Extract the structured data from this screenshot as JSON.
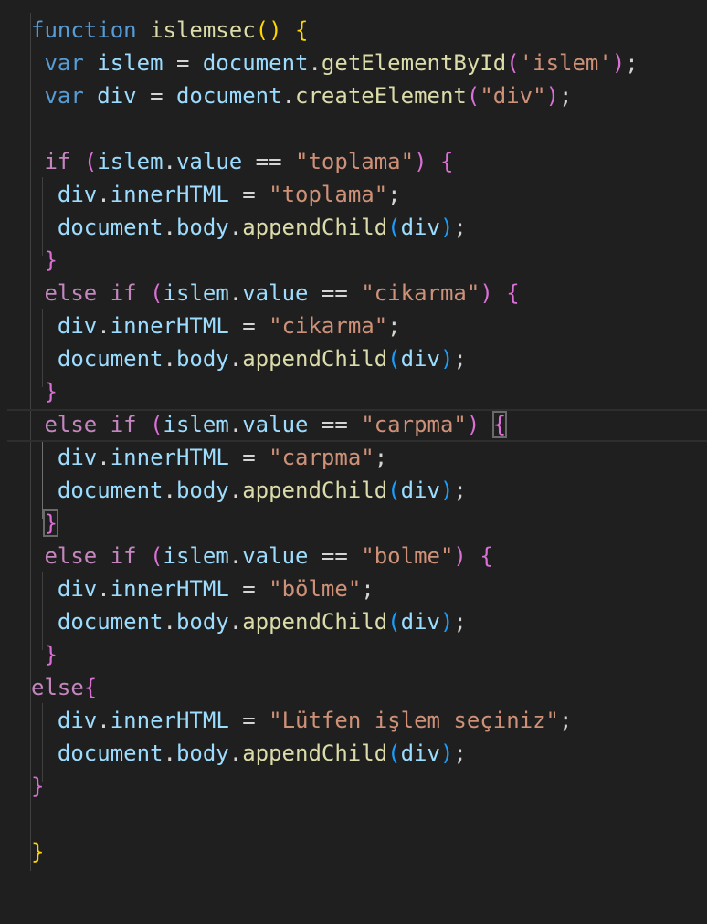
{
  "colors": {
    "background": "#1f1f1f",
    "keyword": "#569cd6",
    "control": "#c586c0",
    "function": "#dcdcaa",
    "variable": "#9cdcfe",
    "string": "#ce9178",
    "bracket_level_1": "#ffd700",
    "bracket_level_2": "#da70d6",
    "bracket_level_3": "#179fff"
  },
  "editor": {
    "highlighted_line": 13,
    "lines": [
      [
        {
          "t": "function",
          "c": "keyword"
        },
        {
          "t": " ",
          "c": "plain"
        },
        {
          "t": "islemsec",
          "c": "function"
        },
        {
          "t": "()",
          "c": "paren1"
        },
        {
          "t": " ",
          "c": "plain"
        },
        {
          "t": "{",
          "c": "paren1"
        }
      ],
      [
        {
          "t": " ",
          "c": "plain"
        },
        {
          "t": "var",
          "c": "keyword"
        },
        {
          "t": " ",
          "c": "plain"
        },
        {
          "t": "islem",
          "c": "variable"
        },
        {
          "t": " = ",
          "c": "operator"
        },
        {
          "t": "document",
          "c": "variable"
        },
        {
          "t": ".",
          "c": "punct"
        },
        {
          "t": "getElementById",
          "c": "function"
        },
        {
          "t": "(",
          "c": "paren2"
        },
        {
          "t": "'islem'",
          "c": "string"
        },
        {
          "t": ")",
          "c": "paren2"
        },
        {
          "t": ";",
          "c": "punct"
        }
      ],
      [
        {
          "t": " ",
          "c": "plain"
        },
        {
          "t": "var",
          "c": "keyword"
        },
        {
          "t": " ",
          "c": "plain"
        },
        {
          "t": "div",
          "c": "variable"
        },
        {
          "t": " = ",
          "c": "operator"
        },
        {
          "t": "document",
          "c": "variable"
        },
        {
          "t": ".",
          "c": "punct"
        },
        {
          "t": "createElement",
          "c": "function"
        },
        {
          "t": "(",
          "c": "paren2"
        },
        {
          "t": "\"div\"",
          "c": "string"
        },
        {
          "t": ")",
          "c": "paren2"
        },
        {
          "t": ";",
          "c": "punct"
        }
      ],
      [],
      [
        {
          "t": " ",
          "c": "plain"
        },
        {
          "t": "if",
          "c": "control"
        },
        {
          "t": " ",
          "c": "plain"
        },
        {
          "t": "(",
          "c": "paren2"
        },
        {
          "t": "islem",
          "c": "variable"
        },
        {
          "t": ".",
          "c": "punct"
        },
        {
          "t": "value",
          "c": "property"
        },
        {
          "t": " == ",
          "c": "operator"
        },
        {
          "t": "\"toplama\"",
          "c": "string"
        },
        {
          "t": ")",
          "c": "paren2"
        },
        {
          "t": " ",
          "c": "plain"
        },
        {
          "t": "{",
          "c": "paren2"
        }
      ],
      [
        {
          "t": "  ",
          "c": "plain"
        },
        {
          "t": "div",
          "c": "variable"
        },
        {
          "t": ".",
          "c": "punct"
        },
        {
          "t": "innerHTML",
          "c": "property"
        },
        {
          "t": " = ",
          "c": "operator"
        },
        {
          "t": "\"toplama\"",
          "c": "string"
        },
        {
          "t": ";",
          "c": "punct"
        }
      ],
      [
        {
          "t": "  ",
          "c": "plain"
        },
        {
          "t": "document",
          "c": "variable"
        },
        {
          "t": ".",
          "c": "punct"
        },
        {
          "t": "body",
          "c": "property"
        },
        {
          "t": ".",
          "c": "punct"
        },
        {
          "t": "appendChild",
          "c": "function"
        },
        {
          "t": "(",
          "c": "paren3"
        },
        {
          "t": "div",
          "c": "variable"
        },
        {
          "t": ")",
          "c": "paren3"
        },
        {
          "t": ";",
          "c": "punct"
        }
      ],
      [
        {
          "t": " ",
          "c": "plain"
        },
        {
          "t": "}",
          "c": "paren2"
        }
      ],
      [
        {
          "t": " ",
          "c": "plain"
        },
        {
          "t": "else",
          "c": "control"
        },
        {
          "t": " ",
          "c": "plain"
        },
        {
          "t": "if",
          "c": "control"
        },
        {
          "t": " ",
          "c": "plain"
        },
        {
          "t": "(",
          "c": "paren2"
        },
        {
          "t": "islem",
          "c": "variable"
        },
        {
          "t": ".",
          "c": "punct"
        },
        {
          "t": "value",
          "c": "property"
        },
        {
          "t": " == ",
          "c": "operator"
        },
        {
          "t": "\"cikarma\"",
          "c": "string"
        },
        {
          "t": ")",
          "c": "paren2"
        },
        {
          "t": " ",
          "c": "plain"
        },
        {
          "t": "{",
          "c": "paren2"
        }
      ],
      [
        {
          "t": "  ",
          "c": "plain"
        },
        {
          "t": "div",
          "c": "variable"
        },
        {
          "t": ".",
          "c": "punct"
        },
        {
          "t": "innerHTML",
          "c": "property"
        },
        {
          "t": " = ",
          "c": "operator"
        },
        {
          "t": "\"cikarma\"",
          "c": "string"
        },
        {
          "t": ";",
          "c": "punct"
        }
      ],
      [
        {
          "t": "  ",
          "c": "plain"
        },
        {
          "t": "document",
          "c": "variable"
        },
        {
          "t": ".",
          "c": "punct"
        },
        {
          "t": "body",
          "c": "property"
        },
        {
          "t": ".",
          "c": "punct"
        },
        {
          "t": "appendChild",
          "c": "function"
        },
        {
          "t": "(",
          "c": "paren3"
        },
        {
          "t": "div",
          "c": "variable"
        },
        {
          "t": ")",
          "c": "paren3"
        },
        {
          "t": ";",
          "c": "punct"
        }
      ],
      [
        {
          "t": " ",
          "c": "plain"
        },
        {
          "t": "}",
          "c": "paren2"
        }
      ],
      [
        {
          "t": " ",
          "c": "plain"
        },
        {
          "t": "else",
          "c": "control"
        },
        {
          "t": " ",
          "c": "plain"
        },
        {
          "t": "if",
          "c": "control"
        },
        {
          "t": " ",
          "c": "plain"
        },
        {
          "t": "(",
          "c": "paren2"
        },
        {
          "t": "islem",
          "c": "variable"
        },
        {
          "t": ".",
          "c": "punct"
        },
        {
          "t": "value",
          "c": "property"
        },
        {
          "t": " == ",
          "c": "operator"
        },
        {
          "t": "\"carpma\"",
          "c": "string"
        },
        {
          "t": ")",
          "c": "paren2"
        },
        {
          "t": " ",
          "c": "plain"
        },
        {
          "t": "{",
          "c": "paren2",
          "boxed": true
        }
      ],
      [
        {
          "t": "  ",
          "c": "plain"
        },
        {
          "t": "div",
          "c": "variable"
        },
        {
          "t": ".",
          "c": "punct"
        },
        {
          "t": "innerHTML",
          "c": "property"
        },
        {
          "t": " = ",
          "c": "operator"
        },
        {
          "t": "\"carpma\"",
          "c": "string"
        },
        {
          "t": ";",
          "c": "punct"
        }
      ],
      [
        {
          "t": "  ",
          "c": "plain"
        },
        {
          "t": "document",
          "c": "variable"
        },
        {
          "t": ".",
          "c": "punct"
        },
        {
          "t": "body",
          "c": "property"
        },
        {
          "t": ".",
          "c": "punct"
        },
        {
          "t": "appendChild",
          "c": "function"
        },
        {
          "t": "(",
          "c": "paren3"
        },
        {
          "t": "div",
          "c": "variable"
        },
        {
          "t": ")",
          "c": "paren3"
        },
        {
          "t": ";",
          "c": "punct"
        }
      ],
      [
        {
          "t": " ",
          "c": "plain"
        },
        {
          "t": "}",
          "c": "paren2",
          "boxed": true
        }
      ],
      [
        {
          "t": " ",
          "c": "plain"
        },
        {
          "t": "else",
          "c": "control"
        },
        {
          "t": " ",
          "c": "plain"
        },
        {
          "t": "if",
          "c": "control"
        },
        {
          "t": " ",
          "c": "plain"
        },
        {
          "t": "(",
          "c": "paren2"
        },
        {
          "t": "islem",
          "c": "variable"
        },
        {
          "t": ".",
          "c": "punct"
        },
        {
          "t": "value",
          "c": "property"
        },
        {
          "t": " == ",
          "c": "operator"
        },
        {
          "t": "\"bolme\"",
          "c": "string"
        },
        {
          "t": ")",
          "c": "paren2"
        },
        {
          "t": " ",
          "c": "plain"
        },
        {
          "t": "{",
          "c": "paren2"
        }
      ],
      [
        {
          "t": "  ",
          "c": "plain"
        },
        {
          "t": "div",
          "c": "variable"
        },
        {
          "t": ".",
          "c": "punct"
        },
        {
          "t": "innerHTML",
          "c": "property"
        },
        {
          "t": " = ",
          "c": "operator"
        },
        {
          "t": "\"bölme\"",
          "c": "string"
        },
        {
          "t": ";",
          "c": "punct"
        }
      ],
      [
        {
          "t": "  ",
          "c": "plain"
        },
        {
          "t": "document",
          "c": "variable"
        },
        {
          "t": ".",
          "c": "punct"
        },
        {
          "t": "body",
          "c": "property"
        },
        {
          "t": ".",
          "c": "punct"
        },
        {
          "t": "appendChild",
          "c": "function"
        },
        {
          "t": "(",
          "c": "paren3"
        },
        {
          "t": "div",
          "c": "variable"
        },
        {
          "t": ")",
          "c": "paren3"
        },
        {
          "t": ";",
          "c": "punct"
        }
      ],
      [
        {
          "t": " ",
          "c": "plain"
        },
        {
          "t": "}",
          "c": "paren2"
        }
      ],
      [
        {
          "t": "else",
          "c": "control"
        },
        {
          "t": "{",
          "c": "paren2"
        }
      ],
      [
        {
          "t": "  ",
          "c": "plain"
        },
        {
          "t": "div",
          "c": "variable"
        },
        {
          "t": ".",
          "c": "punct"
        },
        {
          "t": "innerHTML",
          "c": "property"
        },
        {
          "t": " = ",
          "c": "operator"
        },
        {
          "t": "\"Lütfen işlem seçiniz\"",
          "c": "string"
        },
        {
          "t": ";",
          "c": "punct"
        }
      ],
      [
        {
          "t": "  ",
          "c": "plain"
        },
        {
          "t": "document",
          "c": "variable"
        },
        {
          "t": ".",
          "c": "punct"
        },
        {
          "t": "body",
          "c": "property"
        },
        {
          "t": ".",
          "c": "punct"
        },
        {
          "t": "appendChild",
          "c": "function"
        },
        {
          "t": "(",
          "c": "paren3"
        },
        {
          "t": "div",
          "c": "variable"
        },
        {
          "t": ")",
          "c": "paren3"
        },
        {
          "t": ";",
          "c": "punct"
        }
      ],
      [
        {
          "t": "}",
          "c": "paren2"
        }
      ],
      [],
      [
        {
          "t": "}",
          "c": "paren1"
        }
      ]
    ]
  }
}
